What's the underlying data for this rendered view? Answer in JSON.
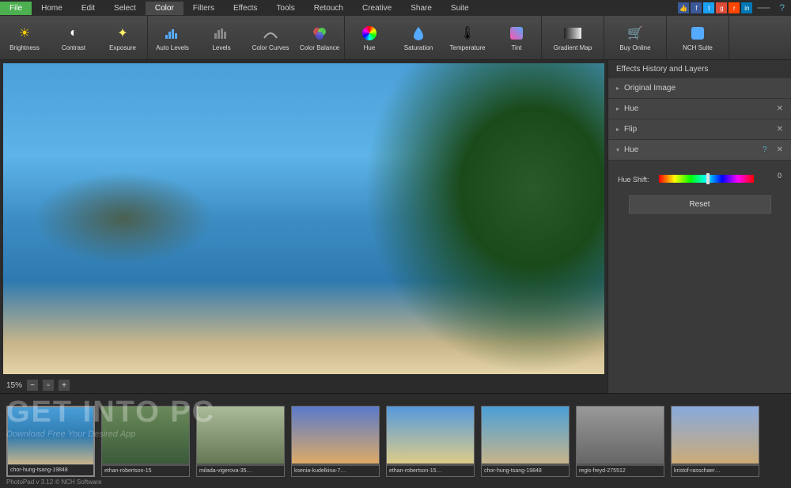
{
  "menu": {
    "items": [
      "File",
      "Home",
      "Edit",
      "Select",
      "Color",
      "Filters",
      "Effects",
      "Tools",
      "Retouch",
      "Creative",
      "Share",
      "Suite"
    ],
    "active": "Color",
    "file": "File"
  },
  "toolbar": {
    "groups": [
      [
        "Brightness",
        "Contrast",
        "Exposure"
      ],
      [
        "Auto Levels",
        "Levels",
        "Color Curves",
        "Color Balance"
      ],
      [
        "Hue",
        "Saturation",
        "Temperature",
        "Tint"
      ],
      [
        "Gradient Map"
      ],
      [
        "Buy Online"
      ],
      [
        "NCH Suite"
      ]
    ]
  },
  "zoom": {
    "level": "15%"
  },
  "panel": {
    "title": "Effects History and Layers",
    "layers": [
      {
        "name": "Original Image",
        "closable": false
      },
      {
        "name": "Hue",
        "closable": true
      },
      {
        "name": "Flip",
        "closable": true
      }
    ],
    "expanded": {
      "name": "Hue"
    },
    "hue": {
      "label": "Hue Shift:",
      "value": "0",
      "reset": "Reset"
    }
  },
  "thumbnails": [
    "chor-hung-tsang-19848",
    "ethan-robertson-15",
    "milada-vigerova-35…",
    "ksenia-kudelkina-7…",
    "ethan-robertson-15…",
    "chor-hung-tsang-19848",
    "regis-freyd-275512",
    "kristof-rasschaer…"
  ],
  "watermark": {
    "title": "GET INTO PC",
    "sub": "Download Free Your Desired App"
  },
  "status": "PhotoPad v 3.12 © NCH Software"
}
